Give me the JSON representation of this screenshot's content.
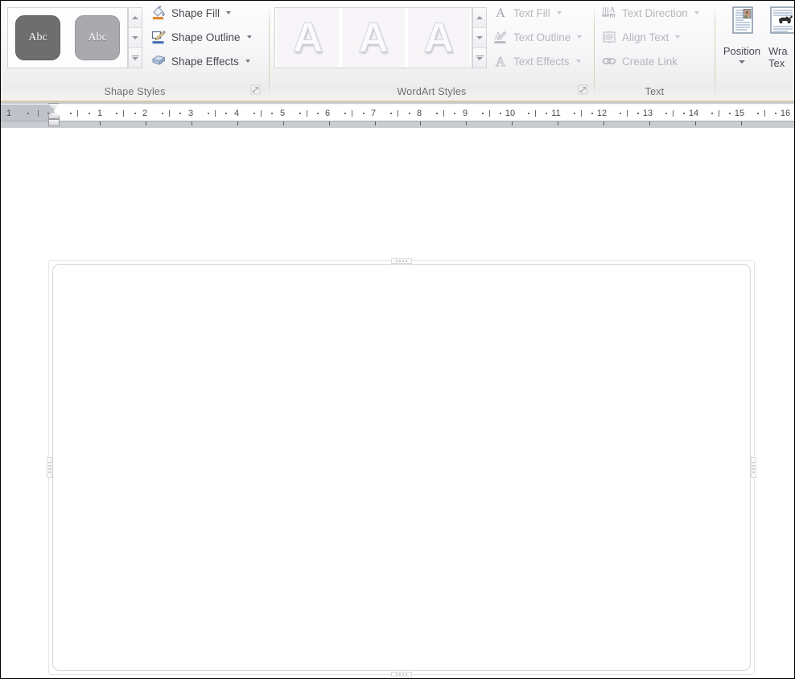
{
  "ribbon": {
    "groups": [
      {
        "label": "Shape Styles"
      },
      {
        "label": "WordArt Styles"
      },
      {
        "label": "Text"
      }
    ],
    "shape_styles": {
      "label": "Shape Styles",
      "gallery_items": [
        {
          "name": "shape-style-intense-effect-dark",
          "text": "Abc",
          "fill": "#6e6e6e",
          "stroke": "#5d5d5d"
        },
        {
          "name": "shape-style-subtle-effect-light",
          "text": "Abc",
          "fill": "#a9a9ae",
          "stroke": "#95959b"
        }
      ],
      "scroll_up": "scroll-up",
      "scroll_down": "scroll-down",
      "more": "more-styles",
      "menus": [
        {
          "label": "Shape Fill",
          "icon": "paint-bucket-icon",
          "caret": true,
          "disabled": false
        },
        {
          "label": "Shape Outline",
          "icon": "pencil-outline-icon",
          "caret": true,
          "disabled": false
        },
        {
          "label": "Shape Effects",
          "icon": "shape-effects-icon",
          "caret": true,
          "disabled": false
        }
      ],
      "launcher": "shape-styles-dialog-launcher"
    },
    "wordart_styles": {
      "label": "WordArt Styles",
      "gallery_items": [
        {
          "name": "wordart-style-1",
          "text": "A"
        },
        {
          "name": "wordart-style-2",
          "text": "A"
        },
        {
          "name": "wordart-style-3",
          "text": "A"
        }
      ],
      "scroll_up": "scroll-up",
      "scroll_down": "scroll-down",
      "more": "more-wordart-styles",
      "menus": [
        {
          "label": "Text Fill",
          "icon": "text-fill-icon",
          "caret": true,
          "disabled": true
        },
        {
          "label": "Text Outline",
          "icon": "text-outline-icon",
          "caret": true,
          "disabled": true
        },
        {
          "label": "Text Effects",
          "icon": "text-effects-icon",
          "caret": true,
          "disabled": true
        }
      ],
      "launcher": "wordart-styles-dialog-launcher"
    },
    "text_group": {
      "label": "Text",
      "menus": [
        {
          "label": "Text Direction",
          "icon": "text-direction-icon",
          "caret": true,
          "disabled": true
        },
        {
          "label": "Align Text",
          "icon": "align-text-icon",
          "caret": true,
          "disabled": true
        },
        {
          "label": "Create Link",
          "icon": "create-link-icon",
          "caret": false,
          "disabled": true
        }
      ]
    },
    "arrange_group": {
      "buttons": [
        {
          "label": "Position",
          "icon": "position-icon",
          "caret": true
        },
        {
          "label": "Wrap Text",
          "label_line1": "Wra",
          "label_line2": "Tex",
          "icon": "wrap-text-icon",
          "caret": false
        }
      ]
    }
  },
  "ruler": {
    "name": "horizontal-ruler",
    "unit": "inches",
    "margin_label": "1",
    "tick_labels": [
      "1",
      "2",
      "3",
      "4",
      "5",
      "6",
      "7",
      "8",
      "9",
      "10",
      "11",
      "12",
      "13",
      "14",
      "15",
      "16"
    ],
    "left_indent_marker": "left-indent-marker",
    "first_line_indent_marker": "first-line-indent-marker",
    "tab_stops": [
      "1",
      "2",
      "3",
      "4",
      "5",
      "6",
      "7",
      "8",
      "9",
      "10",
      "11",
      "12",
      "13",
      "14",
      "15"
    ]
  },
  "canvas": {
    "name": "document-canvas",
    "selected_object": "drawing-canvas-shape",
    "handles": [
      "top-center-handle",
      "bottom-center-handle",
      "left-middle-handle",
      "right-middle-handle"
    ]
  },
  "colors": {
    "ribbon_bg": "#f4f4f6",
    "ribbon_border": "#d7c9a7",
    "ruler_bg": "#c9ccd1",
    "label_text": "#6f6f74",
    "menu_text": "#4a4a50",
    "disabled_text": "#b6b6bc",
    "canvas_bg": "#ffffff",
    "shape_border": "#d7d7da"
  }
}
